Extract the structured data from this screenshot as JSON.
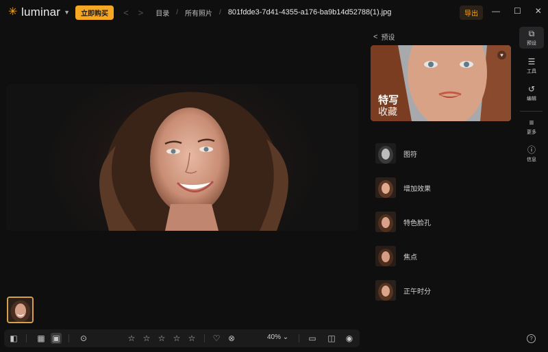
{
  "app": {
    "logo_text": "luminar",
    "buy_label": "立即购买",
    "export_label": "导出"
  },
  "breadcrumb": {
    "items": [
      "目录",
      "所有照片"
    ],
    "file_name": "801fdde3-7d41-4355-a176-ba9b14d52788(1).jpg"
  },
  "toolbar": {
    "zoom": "40%"
  },
  "presets_panel": {
    "back_label": "预设",
    "hero_title": "特写",
    "hero_subtitle": "收藏",
    "items": [
      {
        "label": "图符"
      },
      {
        "label": "增加效果"
      },
      {
        "label": "特色脸孔"
      },
      {
        "label": "焦点"
      },
      {
        "label": "正午时分"
      }
    ]
  },
  "rail": {
    "items": [
      {
        "label": "预设",
        "icon": "layers-icon"
      },
      {
        "label": "工具",
        "icon": "sliders-icon"
      },
      {
        "label": "编辑",
        "icon": "history-icon"
      },
      {
        "label": "更多",
        "icon": "list-icon"
      },
      {
        "label": "信息",
        "icon": "info-icon"
      }
    ]
  },
  "colors": {
    "accent": "#f5a623",
    "background": "#0f0f10"
  }
}
